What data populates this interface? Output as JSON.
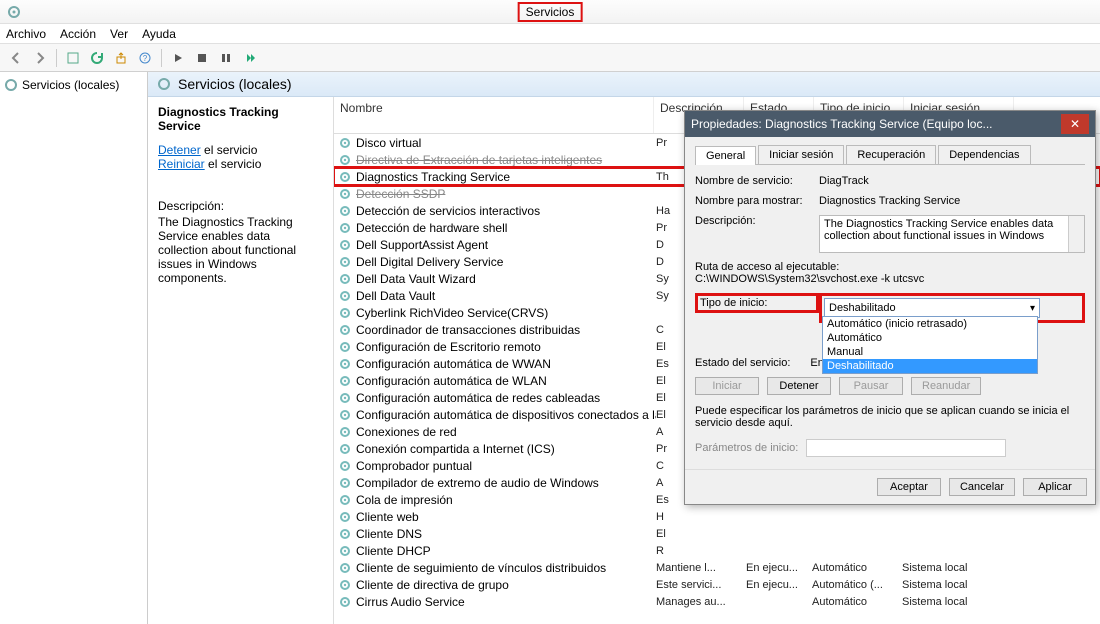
{
  "window": {
    "title": "Servicios"
  },
  "menu": {
    "file": "Archivo",
    "action": "Acción",
    "view": "Ver",
    "help": "Ayuda"
  },
  "tree": {
    "root": "Servicios (locales)"
  },
  "center": {
    "title": "Servicios (locales)"
  },
  "panel": {
    "heading": "Diagnostics Tracking Service",
    "stop": "Detener",
    "stop_suffix": " el servicio",
    "restart": "Reiniciar",
    "restart_suffix": " el servicio",
    "desc_label": "Descripción:",
    "desc": "The Diagnostics Tracking Service enables data collection about functional issues in Windows components."
  },
  "columns": {
    "name": "Nombre",
    "desc": "Descripción",
    "state": "Estado",
    "start": "Tipo de inicio",
    "login": "Iniciar sesión como"
  },
  "services": [
    {
      "n": "Disco virtual",
      "d": "Pr"
    },
    {
      "n": "Directiva de Extracción de tarjetas inteligentes",
      "d": "",
      "strike": true
    },
    {
      "n": "Diagnostics Tracking Service",
      "d": "Th",
      "hl": true
    },
    {
      "n": "Detección SSDP",
      "d": "",
      "strike": true
    },
    {
      "n": "Detección de servicios interactivos",
      "d": "Ha"
    },
    {
      "n": "Detección de hardware shell",
      "d": "Pr"
    },
    {
      "n": "Dell SupportAssist Agent",
      "d": "D"
    },
    {
      "n": "Dell Digital Delivery Service",
      "d": "D"
    },
    {
      "n": "Dell Data Vault Wizard",
      "d": "Sy"
    },
    {
      "n": "Dell Data Vault",
      "d": "Sy"
    },
    {
      "n": "Cyberlink RichVideo Service(CRVS)",
      "d": ""
    },
    {
      "n": "Coordinador de transacciones distribuidas",
      "d": "C"
    },
    {
      "n": "Configuración de Escritorio remoto",
      "d": "El"
    },
    {
      "n": "Configuración automática de WWAN",
      "d": "Es"
    },
    {
      "n": "Configuración automática de WLAN",
      "d": "El"
    },
    {
      "n": "Configuración automática de redes cableadas",
      "d": "El"
    },
    {
      "n": "Configuración automática de dispositivos conectados a la red",
      "d": "El"
    },
    {
      "n": "Conexiones de red",
      "d": "A"
    },
    {
      "n": "Conexión compartida a Internet (ICS)",
      "d": "Pr"
    },
    {
      "n": "Comprobador puntual",
      "d": "C"
    },
    {
      "n": "Compilador de extremo de audio de Windows",
      "d": "A"
    },
    {
      "n": "Cola de impresión",
      "d": "Es"
    },
    {
      "n": "Cliente web",
      "d": "H"
    },
    {
      "n": "Cliente DNS",
      "d": "El"
    },
    {
      "n": "Cliente DHCP",
      "d": "R"
    },
    {
      "n": "Cliente de seguimiento de vínculos distribuidos",
      "d": "Mantiene l...",
      "s": "En ejecu...",
      "t": "Automático",
      "l": "Sistema local",
      "tail": true
    },
    {
      "n": "Cliente de directiva de grupo",
      "d": "Este servici...",
      "s": "En ejecu...",
      "t": "Automático (...",
      "l": "Sistema local",
      "tail": true
    },
    {
      "n": "Cirrus Audio Service",
      "d": "Manages au...",
      "s": "",
      "t": "Automático",
      "l": "Sistema local",
      "tail": true
    }
  ],
  "dialog": {
    "title": "Propiedades: Diagnostics Tracking Service (Equipo loc...",
    "tabs": {
      "general": "General",
      "logon": "Iniciar sesión",
      "recovery": "Recuperación",
      "deps": "Dependencias"
    },
    "svc_name_label": "Nombre de servicio:",
    "svc_name": "DiagTrack",
    "display_name_label": "Nombre para mostrar:",
    "display_name": "Diagnostics Tracking Service",
    "desc_label": "Descripción:",
    "desc": "The Diagnostics Tracking Service enables data collection about functional issues in Windows",
    "path_label": "Ruta de acceso al ejecutable:",
    "path": "C:\\WINDOWS\\System32\\svchost.exe -k utcsvc",
    "start_type_label": "Tipo de inicio:",
    "start_type_value": "Deshabilitado",
    "options": [
      "Automático (inicio retrasado)",
      "Automático",
      "Manual",
      "Deshabilitado"
    ],
    "state_label": "Estado del servicio:",
    "state_value": "En ejecución",
    "btn_start": "Iniciar",
    "btn_stop": "Detener",
    "btn_pause": "Pausar",
    "btn_resume": "Reanudar",
    "note": "Puede especificar los parámetros de inicio que se aplican cuando se inicia el servicio desde aquí.",
    "params_label": "Parámetros de inicio:",
    "ok": "Aceptar",
    "cancel": "Cancelar",
    "apply": "Aplicar"
  }
}
